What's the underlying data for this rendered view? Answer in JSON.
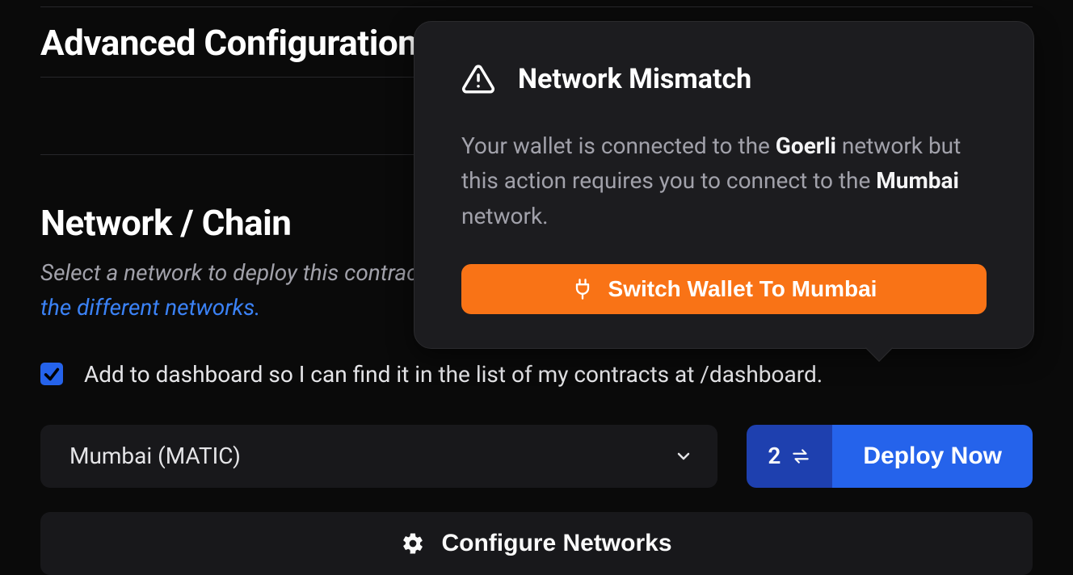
{
  "advanced": {
    "title": "Advanced Configuration"
  },
  "network": {
    "title": "Network / Chain",
    "desc": "Select a network to deploy this contract on. We recommend starting with a testnet.",
    "link": "Learn more about the different networks.",
    "checkbox_label": "Add to dashboard so I can find it in the list of my contracts at /dashboard.",
    "select_value": "Mumbai (MATIC)",
    "tx_count": "2",
    "deploy_label": "Deploy Now",
    "configure_label": "Configure Networks"
  },
  "popover": {
    "title": "Network Mismatch",
    "msg_pre": "Your wallet is connected to the ",
    "msg_net1": "Goerli",
    "msg_mid": " network but this action requires you to connect to the ",
    "msg_net2": "Mumbai",
    "msg_post": " network.",
    "switch_label": "Switch Wallet To Mumbai"
  }
}
